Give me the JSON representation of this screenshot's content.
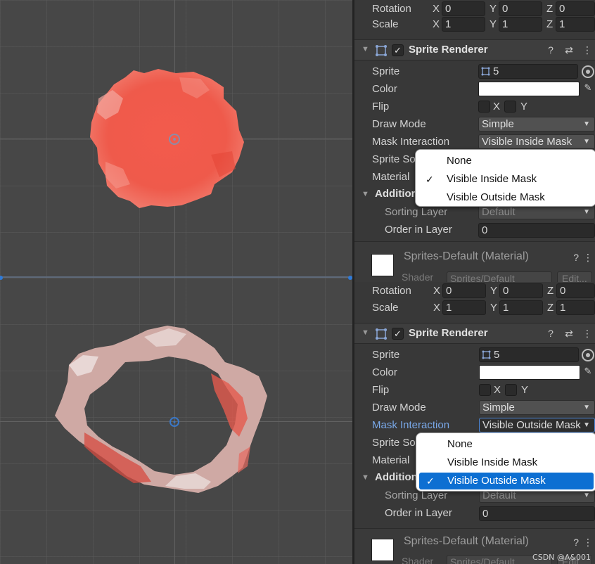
{
  "top": {
    "transform": {
      "rotation": {
        "label": "Rotation",
        "x": "0",
        "y": "0",
        "z": "0"
      },
      "scale": {
        "label": "Scale",
        "x": "1",
        "y": "1",
        "z": "1"
      },
      "axis_x": "X",
      "axis_y": "Y",
      "axis_z": "Z"
    },
    "sprite_renderer": {
      "title": "Sprite Renderer",
      "sprite_label": "Sprite",
      "sprite_value": "5",
      "color_label": "Color",
      "flip_label": "Flip",
      "flip_x": "X",
      "flip_y": "Y",
      "draw_mode_label": "Draw Mode",
      "draw_mode_value": "Simple",
      "mask_label": "Mask Interaction",
      "mask_value": "Visible Inside Mask",
      "sprite_sort_label": "Sprite So",
      "material_label": "Material",
      "additional_label": "Addition",
      "sorting_layer_label": "Sorting Layer",
      "sorting_layer_value": "Default",
      "order_label": "Order in Layer",
      "order_value": "0"
    },
    "menu": {
      "items": [
        {
          "label": "None",
          "checked": false
        },
        {
          "label": "Visible Inside Mask",
          "checked": true
        },
        {
          "label": "Visible Outside Mask",
          "checked": false
        }
      ],
      "check": "✓"
    },
    "material": {
      "title": "Sprites-Default (Material)",
      "shader_label": "Shader",
      "shader_value": "Sprites/Default",
      "edit_label": "Edit..."
    }
  },
  "bottom": {
    "transform": {
      "rotation": {
        "label": "Rotation",
        "x": "0",
        "y": "0",
        "z": "0"
      },
      "scale": {
        "label": "Scale",
        "x": "1",
        "y": "1",
        "z": "1"
      },
      "axis_x": "X",
      "axis_y": "Y",
      "axis_z": "Z"
    },
    "sprite_renderer": {
      "title": "Sprite Renderer",
      "sprite_label": "Sprite",
      "sprite_value": "5",
      "color_label": "Color",
      "flip_label": "Flip",
      "flip_x": "X",
      "flip_y": "Y",
      "draw_mode_label": "Draw Mode",
      "draw_mode_value": "Simple",
      "mask_label": "Mask Interaction",
      "mask_value": "Visible Outside Mask",
      "sprite_sort_label": "Sprite So",
      "material_label": "Material",
      "additional_label": "Addition",
      "sorting_layer_label": "Sorting Layer",
      "sorting_layer_value": "Default",
      "order_label": "Order in Layer",
      "order_value": "0"
    },
    "menu": {
      "items": [
        {
          "label": "None",
          "checked": false
        },
        {
          "label": "Visible Inside Mask",
          "checked": false
        },
        {
          "label": "Visible Outside Mask",
          "checked": true
        }
      ],
      "check": "✓"
    },
    "material": {
      "title": "Sprites-Default (Material)",
      "shader_label": "Shader",
      "shader_value": "Sprites/Default",
      "edit_label": "Edit..."
    }
  },
  "icons": {
    "help": "?",
    "presets": "⇄",
    "kebab": "⋮",
    "fold": "▼",
    "picker": "✎",
    "dropdown": "▼",
    "sprite_icon": "sprite-icon",
    "component_icon": "sprite-renderer-icon"
  },
  "colors": {
    "accent": "#0d6fd2",
    "splat": "#ee5548",
    "panel": "#383838",
    "scene": "#474747"
  },
  "watermark": "CSDN @A&001"
}
